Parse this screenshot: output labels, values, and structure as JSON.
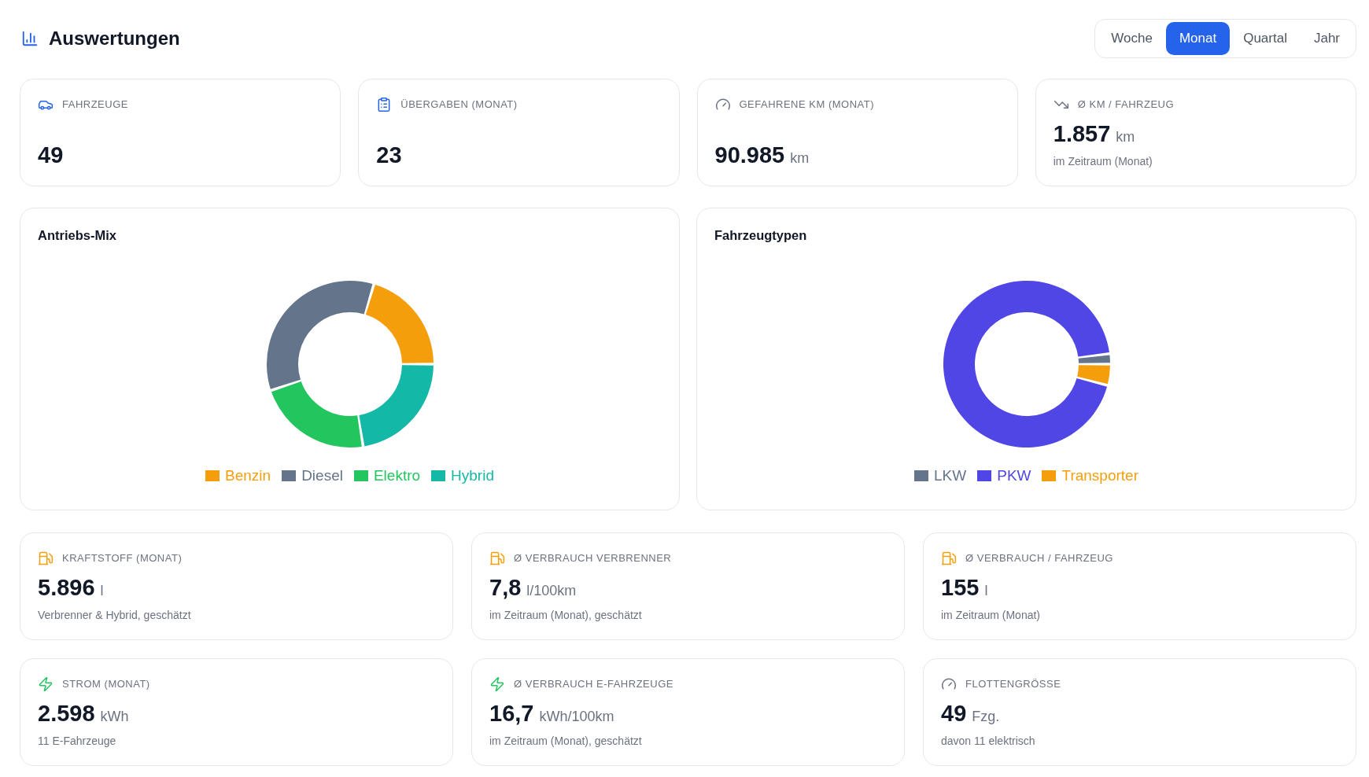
{
  "header": {
    "title": "Auswertungen"
  },
  "period_tabs": [
    {
      "label": "Woche",
      "selected": false
    },
    {
      "label": "Monat",
      "selected": true
    },
    {
      "label": "Quartal",
      "selected": false
    },
    {
      "label": "Jahr",
      "selected": false
    }
  ],
  "kpi_cards": [
    {
      "label": "FAHRZEUGE",
      "value": "49"
    },
    {
      "label": "ÜBERGABEN (MONAT)",
      "value": "23"
    },
    {
      "label": "GEFAHRENE KM (MONAT)",
      "value": "90.985",
      "unit": "km"
    },
    {
      "label": "Ø KM / FAHRZEUG",
      "value": "1.857",
      "unit": "km",
      "note": "im Zeitraum (Monat)"
    }
  ],
  "charts": [
    {
      "chart_data": {
        "type": "donut",
        "title": "Antriebs-Mix",
        "categories": [
          "Benzin",
          "Diesel",
          "Elektro",
          "Hybrid"
        ],
        "values": [
          20.4,
          34.7,
          22.4,
          22.5
        ],
        "colors": [
          "#f59e0b",
          "#64748b",
          "#22c55e",
          "#14b8a6"
        ],
        "legend": "bottom"
      }
    },
    {
      "chart_data": {
        "type": "donut",
        "title": "Fahrzeugtypen",
        "categories": [
          "LKW",
          "PKW",
          "Transporter"
        ],
        "values": [
          2.0,
          93.9,
          4.1
        ],
        "colors": [
          "#64748b",
          "#4f46e5",
          "#f59e0b"
        ],
        "legend": "bottom"
      }
    }
  ],
  "consumption_cards": [
    {
      "label": "KRAFTSTOFF (MONAT)",
      "value": "5.896",
      "unit": "l",
      "note": "Verbrenner & Hybrid, geschätzt"
    },
    {
      "label": "Ø VERBRAUCH VERBRENNER",
      "value": "7,8",
      "unit": "l/100km",
      "note": "im Zeitraum (Monat), geschätzt"
    },
    {
      "label": "Ø VERBRAUCH / FAHRZEUG",
      "value": "155",
      "unit": "l",
      "note": "im Zeitraum (Monat)"
    },
    {
      "label": "STROM (MONAT)",
      "value": "2.598",
      "unit": "kWh",
      "note": "11 E-Fahrzeuge"
    },
    {
      "label": "Ø VERBRAUCH E-FAHRZEUGE",
      "value": "16,7",
      "unit": "kWh/100km",
      "note": "im Zeitraum (Monat), geschätzt"
    },
    {
      "label": "FLOTTENGRÖSSE",
      "value": "49",
      "unit": "Fzg.",
      "note": "davon 11 elektrisch"
    }
  ]
}
